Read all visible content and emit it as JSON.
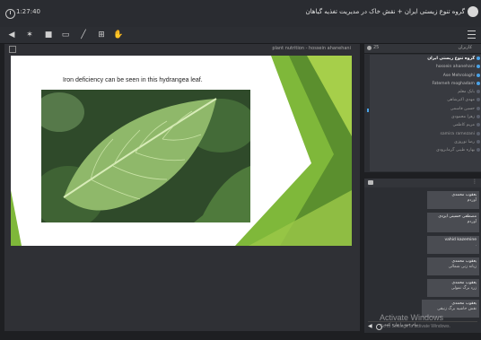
{
  "topbar": {
    "timer": "1:27:40",
    "room_title": "گروه تنوع زیستی ایران + نقش خاک در مدیریت تغذیه گیاهان",
    "icons": [
      "clock-icon",
      "user-icon"
    ]
  },
  "toolbar": {
    "icons": [
      "speaker-icon",
      "microphone-icon",
      "camera-icon",
      "screen-icon",
      "pen-icon",
      "plus-icon",
      "hand-icon",
      "menu-icon"
    ]
  },
  "stage": {
    "presenter_label": "plant nutrition - hossein ahanehani",
    "slide_text": "Iron deficiency can be seen in this hydrangea leaf."
  },
  "users": {
    "count": "25",
    "label": "کاربران",
    "list": [
      {
        "name": "گروه تنوع زیستی ایران",
        "self": true
      },
      {
        "name": "hossein ahanehani",
        "self": false
      },
      {
        "name": "Ase Mehrologhi",
        "self": false
      },
      {
        "name": "Fatemeh moghadam",
        "self": false
      },
      {
        "name": "بابک معلم",
        "self": false,
        "dim": true
      },
      {
        "name": "مهدی اکبرشاهی",
        "self": false,
        "dim": true
      },
      {
        "name": "حسین قاسمی",
        "self": false,
        "dim": true
      },
      {
        "name": "زهرا محمودی",
        "self": false,
        "dim": true
      },
      {
        "name": "مریم کاظمی",
        "self": false,
        "dim": true
      },
      {
        "name": "samira ramezani",
        "self": false,
        "dim": true
      },
      {
        "name": "رضا نوروزی",
        "self": false,
        "dim": true
      },
      {
        "name": "بهاره طیبی گرمابرودی",
        "self": false,
        "dim": true
      }
    ]
  },
  "chat": {
    "messages": [
      {
        "who": "یعقوب محمدی",
        "text": "آوردم"
      },
      {
        "who": "مصطفی حسینی ایزدی",
        "text": "آوردم"
      },
      {
        "who": "vahid kazemine",
        "text": "."
      },
      {
        "who": "یعقوب محمدی",
        "text": "زبانه زنی شمالی"
      },
      {
        "who": "یعقوب محمدی",
        "text": "زرد برگ نمولی"
      },
      {
        "who": "یعقوب محمدی",
        "text": "نقش حاشیه برگ زنبقی"
      }
    ],
    "placeholder": "پیام خود را وارد کنید"
  },
  "overlay": {
    "activate_title": "Activate Windows",
    "activate_sub": "Go to Settings to activate Windows."
  },
  "colors": {
    "slide_green_dark": "#5b8f2e",
    "slide_green_light": "#a6cf4a",
    "user_dot": "#4aa3e8",
    "bg": "#1e1f22"
  }
}
